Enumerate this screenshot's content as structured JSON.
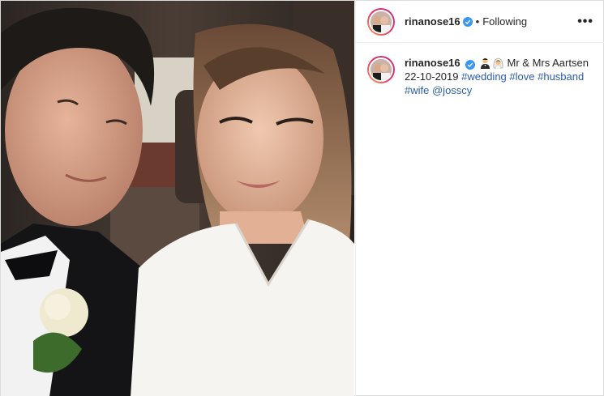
{
  "post": {
    "username": "rinanose16",
    "separator": "•",
    "follow_status": "Following",
    "more_label": "•••",
    "caption": {
      "username": "rinanose16",
      "text": "Mr & Mrs Aartsen 22-10-2019",
      "hashtags": [
        "#wedding",
        "#love",
        "#husband",
        "#wife"
      ],
      "mention": "@josscy"
    },
    "icons": {
      "verified": "verified-badge-icon",
      "emoji_groom": "man-in-tuxedo-emoji",
      "emoji_bride": "bride-with-veil-emoji",
      "more": "more-options-icon"
    },
    "colors": {
      "verified": "#3897f0",
      "link": "#2a5db0",
      "text": "#262626",
      "border": "#dbdbdb"
    }
  }
}
